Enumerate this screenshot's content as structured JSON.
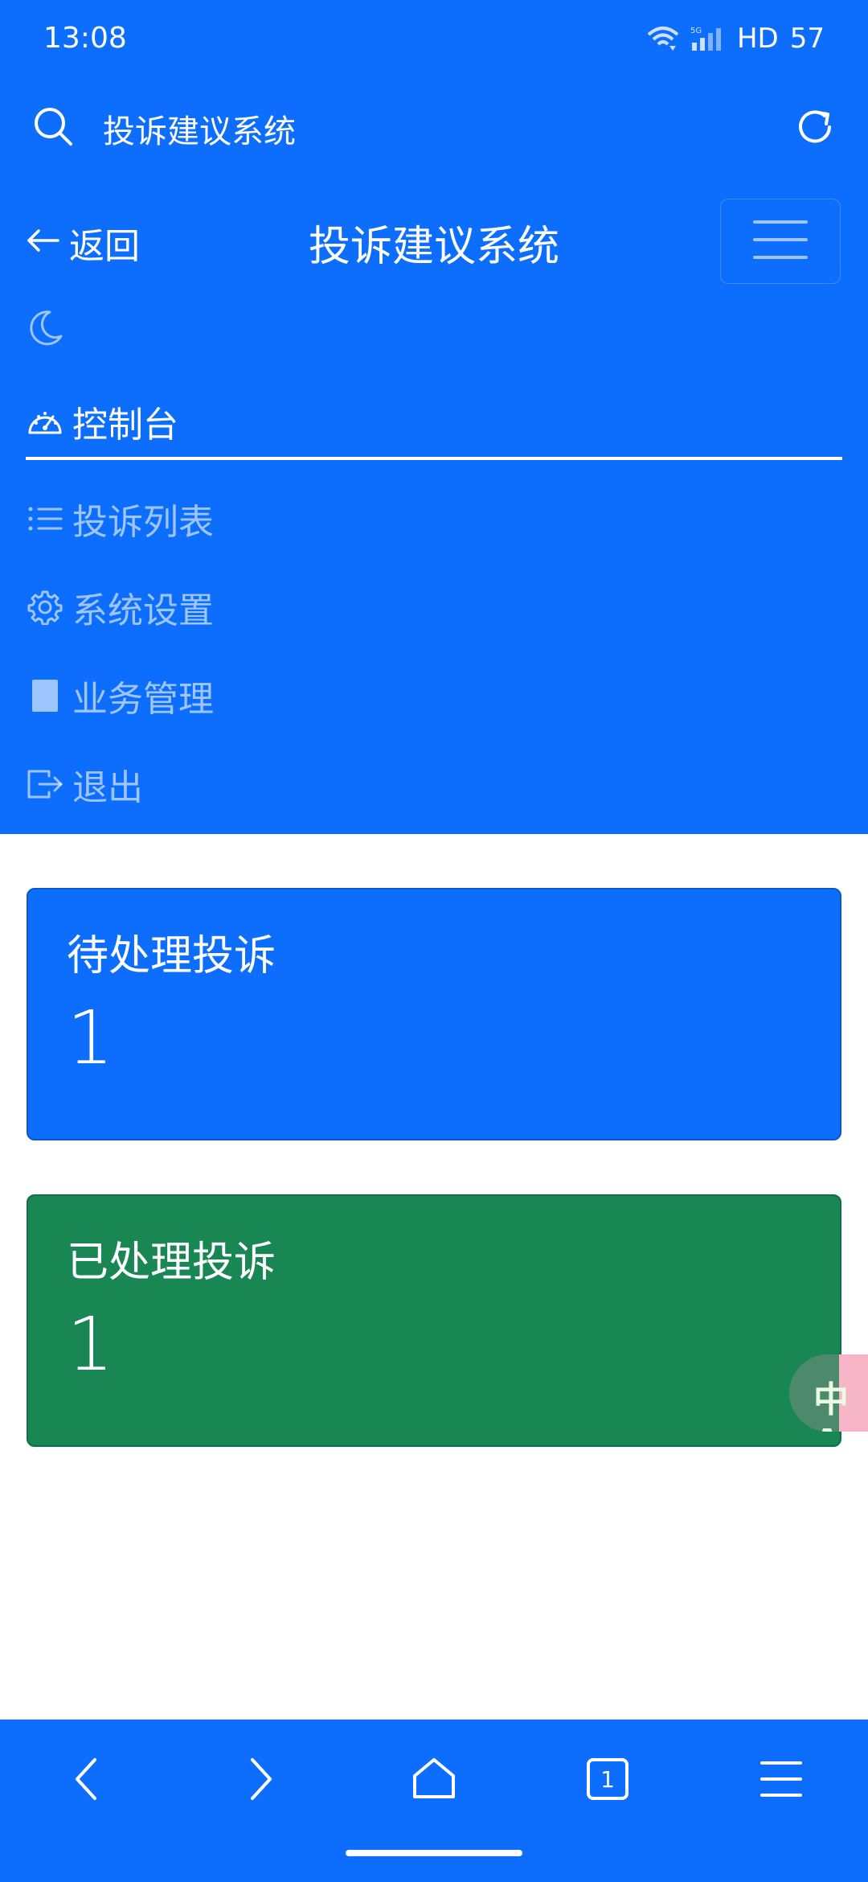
{
  "status_bar": {
    "time": "13:08",
    "network": "HD",
    "battery": "57",
    "icons": [
      "wifi-icon",
      "signal-5g-icon"
    ]
  },
  "browser": {
    "page_title": "投诉建议系统",
    "icons": [
      "search-icon",
      "refresh-icon"
    ]
  },
  "navbar": {
    "back_label": "返回",
    "brand": "投诉建议系统",
    "icons": [
      "arrow-left-icon",
      "hamburger-icon",
      "moon-icon"
    ]
  },
  "menu": [
    {
      "label": "控制台",
      "icon": "speedometer-icon",
      "active": true
    },
    {
      "label": "投诉列表",
      "icon": "list-icon",
      "active": false
    },
    {
      "label": "系统设置",
      "icon": "gear-icon",
      "active": false
    },
    {
      "label": "业务管理",
      "icon": "book-icon",
      "active": false
    },
    {
      "label": "退出",
      "icon": "logout-icon",
      "active": false
    }
  ],
  "cards": {
    "pending": {
      "label": "待处理投诉",
      "count": "1"
    },
    "done": {
      "label": "已处理投诉",
      "count": "1"
    }
  },
  "translate_button": {
    "text": "中A"
  },
  "bottom_bar": {
    "tab_count": "1",
    "icons": [
      "back-icon",
      "forward-icon",
      "home-icon",
      "tabs-icon",
      "menu-icon"
    ]
  },
  "colors": {
    "primary": "#0d6efd",
    "success": "#198754",
    "text_on_primary": "#ffffff"
  }
}
